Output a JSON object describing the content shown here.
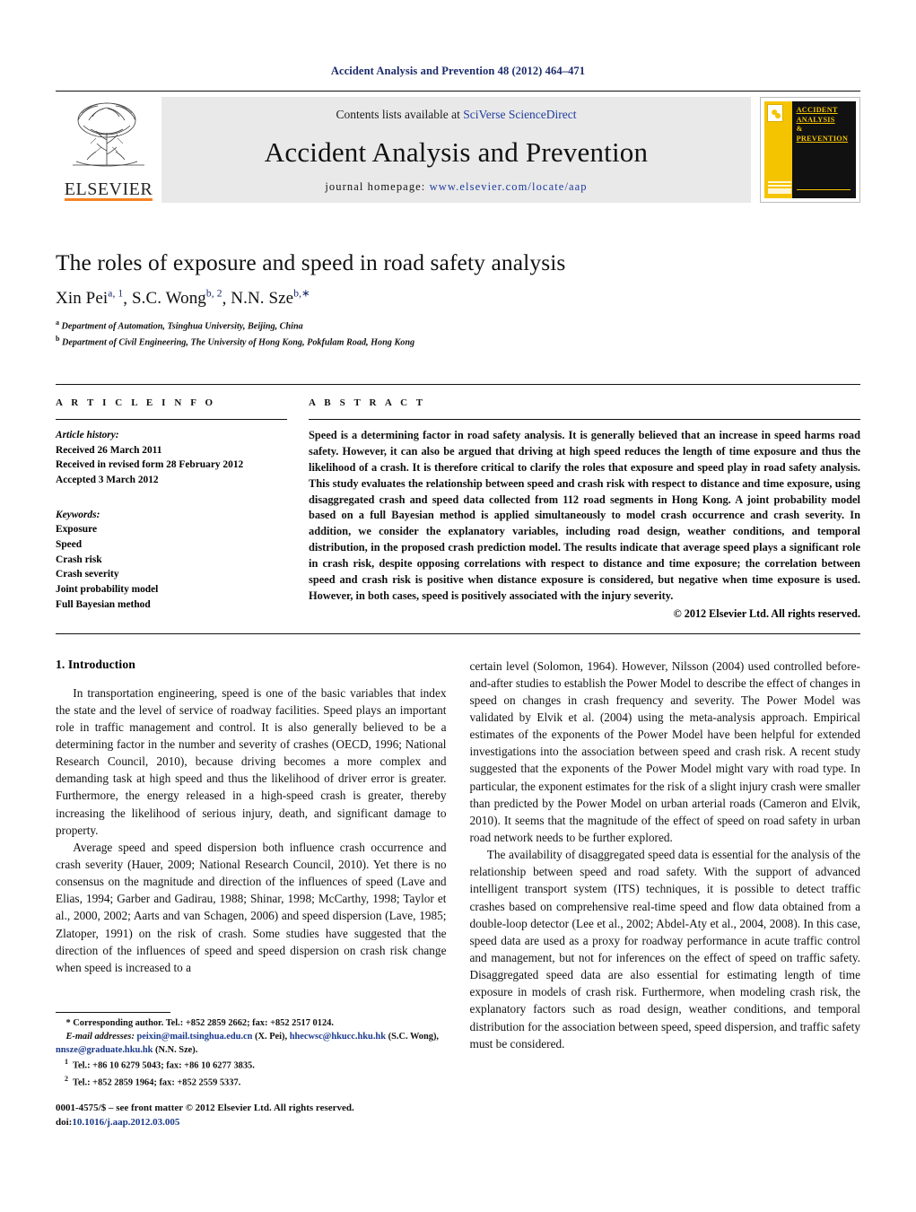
{
  "running_head": "Accident Analysis and Prevention 48 (2012) 464–471",
  "masthead": {
    "publisher_name": "ELSEVIER",
    "contents_prefix": "Contents lists available at ",
    "contents_link": "SciVerse ScienceDirect",
    "journal_title": "Accident Analysis and Prevention",
    "homepage_prefix": "journal homepage: ",
    "homepage_url": "www.elsevier.com/locate/aap",
    "cover": {
      "line1": "ACCIDENT",
      "line2": "ANALYSIS",
      "line3": "&",
      "line4": "PREVENTION"
    }
  },
  "article": {
    "title": "The roles of exposure and speed in road safety analysis",
    "authors": [
      {
        "name": "Xin Pei",
        "marks": "a, 1"
      },
      {
        "name": "S.C. Wong",
        "marks": "b, 2"
      },
      {
        "name": "N.N. Sze",
        "marks": "b,∗"
      }
    ],
    "affiliations": [
      {
        "mark": "a",
        "text": "Department of Automation, Tsinghua University, Beijing, China"
      },
      {
        "mark": "b",
        "text": "Department of Civil Engineering, The University of Hong Kong, Pokfulam Road, Hong Kong"
      }
    ]
  },
  "article_info": {
    "heading": "A R T I C L E  I N F O",
    "history_label": "Article history:",
    "history": [
      "Received 26 March 2011",
      "Received in revised form 28 February 2012",
      "Accepted 3 March 2012"
    ],
    "keywords_label": "Keywords:",
    "keywords": [
      "Exposure",
      "Speed",
      "Crash risk",
      "Crash severity",
      "Joint probability model",
      "Full Bayesian method"
    ]
  },
  "abstract": {
    "heading": "A B S T R A C T",
    "text": "Speed is a determining factor in road safety analysis. It is generally believed that an increase in speed harms road safety. However, it can also be argued that driving at high speed reduces the length of time exposure and thus the likelihood of a crash. It is therefore critical to clarify the roles that exposure and speed play in road safety analysis. This study evaluates the relationship between speed and crash risk with respect to distance and time exposure, using disaggregated crash and speed data collected from 112 road segments in Hong Kong. A joint probability model based on a full Bayesian method is applied simultaneously to model crash occurrence and crash severity. In addition, we consider the explanatory variables, including road design, weather conditions, and temporal distribution, in the proposed crash prediction model. The results indicate that average speed plays a significant role in crash risk, despite opposing correlations with respect to distance and time exposure; the correlation between speed and crash risk is positive when distance exposure is considered, but negative when time exposure is used. However, in both cases, speed is positively associated with the injury severity.",
    "copyright": "© 2012 Elsevier Ltd. All rights reserved."
  },
  "body": {
    "section_number_title": "1.  Introduction",
    "left_paragraphs": [
      "In transportation engineering, speed is one of the basic variables that index the state and the level of service of roadway facilities. Speed plays an important role in traffic management and control. It is also generally believed to be a determining factor in the number and severity of crashes (OECD, 1996; National Research Council, 2010), because driving becomes a more complex and demanding task at high speed and thus the likelihood of driver error is greater. Furthermore, the energy released in a high-speed crash is greater, thereby increasing the likelihood of serious injury, death, and significant damage to property.",
      "Average speed and speed dispersion both influence crash occurrence and crash severity (Hauer, 2009; National Research Council, 2010). Yet there is no consensus on the magnitude and direction of the influences of speed (Lave and Elias, 1994; Garber and Gadirau, 1988; Shinar, 1998; McCarthy, 1998; Taylor et al., 2000, 2002; Aarts and van Schagen, 2006) and speed dispersion (Lave, 1985; Zlatoper, 1991) on the risk of crash. Some studies have suggested that the direction of the influences of speed and speed dispersion on crash risk change when speed is increased to a"
    ],
    "right_paragraphs": [
      "certain level (Solomon, 1964). However, Nilsson (2004) used controlled before-and-after studies to establish the Power Model to describe the effect of changes in speed on changes in crash frequency and severity. The Power Model was validated by Elvik et al. (2004) using the meta-analysis approach. Empirical estimates of the exponents of the Power Model have been helpful for extended investigations into the association between speed and crash risk. A recent study suggested that the exponents of the Power Model might vary with road type. In particular, the exponent estimates for the risk of a slight injury crash were smaller than predicted by the Power Model on urban arterial roads (Cameron and Elvik, 2010). It seems that the magnitude of the effect of speed on road safety in urban road network needs to be further explored.",
      "The availability of disaggregated speed data is essential for the analysis of the relationship between speed and road safety. With the support of advanced intelligent transport system (ITS) techniques, it is possible to detect traffic crashes based on comprehensive real-time speed and flow data obtained from a double-loop detector (Lee et al., 2002; Abdel-Aty et al., 2004, 2008). In this case, speed data are used as a proxy for roadway performance in acute traffic control and management, but not for inferences on the effect of speed on traffic safety. Disaggregated speed data are also essential for estimating length of time exposure in models of crash risk. Furthermore, when modeling crash risk, the explanatory factors such as road design, weather conditions, and temporal distribution for the association between speed, speed dispersion, and traffic safety must be considered."
    ]
  },
  "footnotes": {
    "corresponding": "Corresponding author. Tel.: +852 2859 2662; fax: +852 2517 0124.",
    "email_label": "E-mail addresses:",
    "email_1": "peixin@mail.tsinghua.edu.cn",
    "email_1_owner": "(X. Pei),",
    "email_2": "hhecwsc@hkucc.hku.hk",
    "email_2_owner": "(S.C. Wong),",
    "email_3": "nnsze@graduate.hku.hk",
    "email_3_owner": "(N.N. Sze).",
    "tel_1": "Tel.: +86 10 6279 5043; fax: +86 10 6277 3835.",
    "tel_2": "Tel.: +852 2859 1964; fax: +852 2559 5337."
  },
  "imprint": {
    "line1": "0001-4575/$ – see front matter © 2012 Elsevier Ltd. All rights reserved.",
    "doi_label": "doi:",
    "doi_value": "10.1016/j.aap.2012.03.005"
  },
  "colors": {
    "link": "#1b3a8c",
    "running_head": "#1b2a6b",
    "elsevier_orange": "#f58220",
    "cover_yellow": "#f5c400",
    "banner_gray": "#e9e9e9"
  }
}
